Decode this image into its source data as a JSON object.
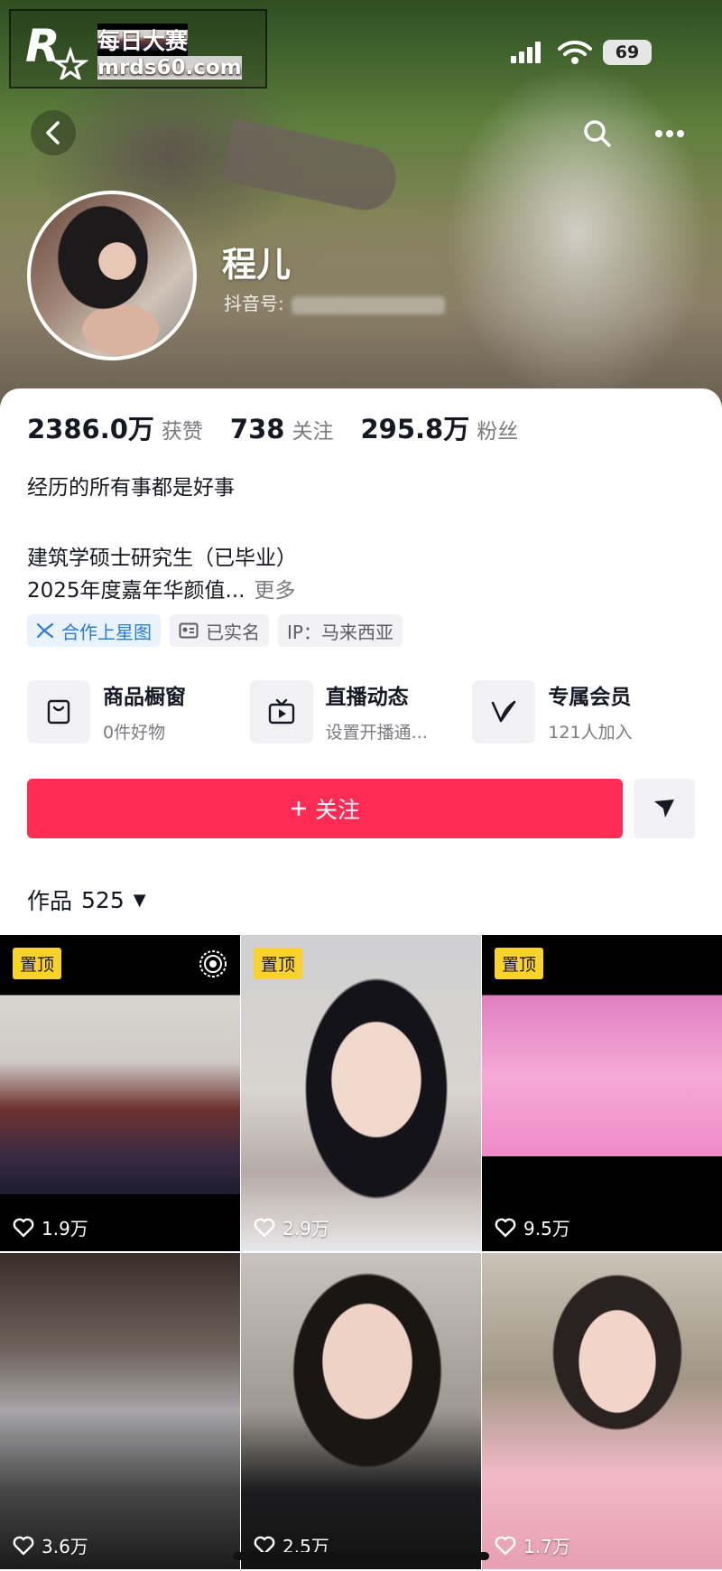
{
  "watermark": {
    "line1": "每日大赛",
    "line2": "mrds60.com"
  },
  "status_bar": {
    "battery": "69"
  },
  "profile": {
    "nickname": "程儿",
    "id_label": "抖音号:"
  },
  "stats": [
    {
      "value": "2386.0万",
      "label": "获赞"
    },
    {
      "value": "738",
      "label": "关注"
    },
    {
      "value": "295.8万",
      "label": "粉丝"
    }
  ],
  "bio": {
    "line1": "经历的所有事都是好事",
    "line2": "建筑学硕士研究生（已毕业）",
    "line3": "2025年度嘉年华颜值...",
    "more": "更多"
  },
  "tags": [
    {
      "label": "合作上星图",
      "icon": "star-map-icon"
    },
    {
      "label": "已实名",
      "icon": "id-card-icon"
    },
    {
      "label": "IP：马来西亚"
    }
  ],
  "features": [
    {
      "title": "商品橱窗",
      "sub": "0件好物",
      "icon": "shopping-bag-icon"
    },
    {
      "title": "直播动态",
      "sub": "设置开播通...",
      "icon": "tv-icon"
    },
    {
      "title": "专属会员",
      "sub": "121人加入",
      "icon": "member-v-icon"
    }
  ],
  "actions": {
    "follow": "关注"
  },
  "works": {
    "label": "作品",
    "count": "525"
  },
  "videos": [
    {
      "pinned": "置顶",
      "likes": "1.9万"
    },
    {
      "pinned": "置顶",
      "likes": "2.9万"
    },
    {
      "pinned": "置顶",
      "likes": "9.5万"
    },
    {
      "likes": "3.6万"
    },
    {
      "likes": "2.5万"
    },
    {
      "likes": "1.7万"
    }
  ],
  "colors": {
    "accent": "#fe2c55",
    "pin": "#f9d22c",
    "link": "#2a7bd4"
  }
}
